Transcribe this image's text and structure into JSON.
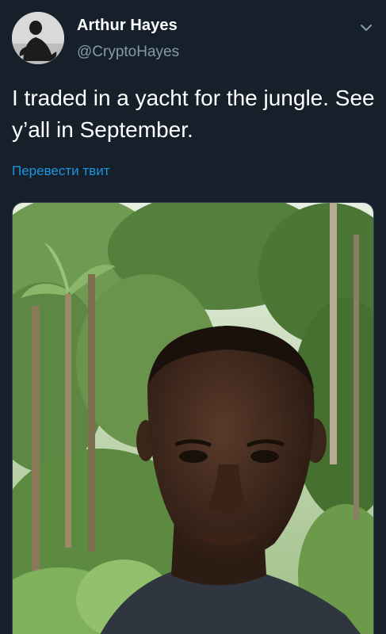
{
  "tweet": {
    "display_name": "Arthur Hayes",
    "handle": "@CryptoHayes",
    "text": "I traded in a yacht for the jungle. See y’all in September.",
    "translate_label": "Перевести твит"
  },
  "icons": {
    "menu": "chevron-down-icon",
    "avatar": "avatar-photo",
    "media": "selfie-photo-jungle"
  },
  "colors": {
    "background": "#15202b",
    "primary_text": "#ffffff",
    "secondary_text": "#8899a6",
    "link": "#1b95e0"
  }
}
